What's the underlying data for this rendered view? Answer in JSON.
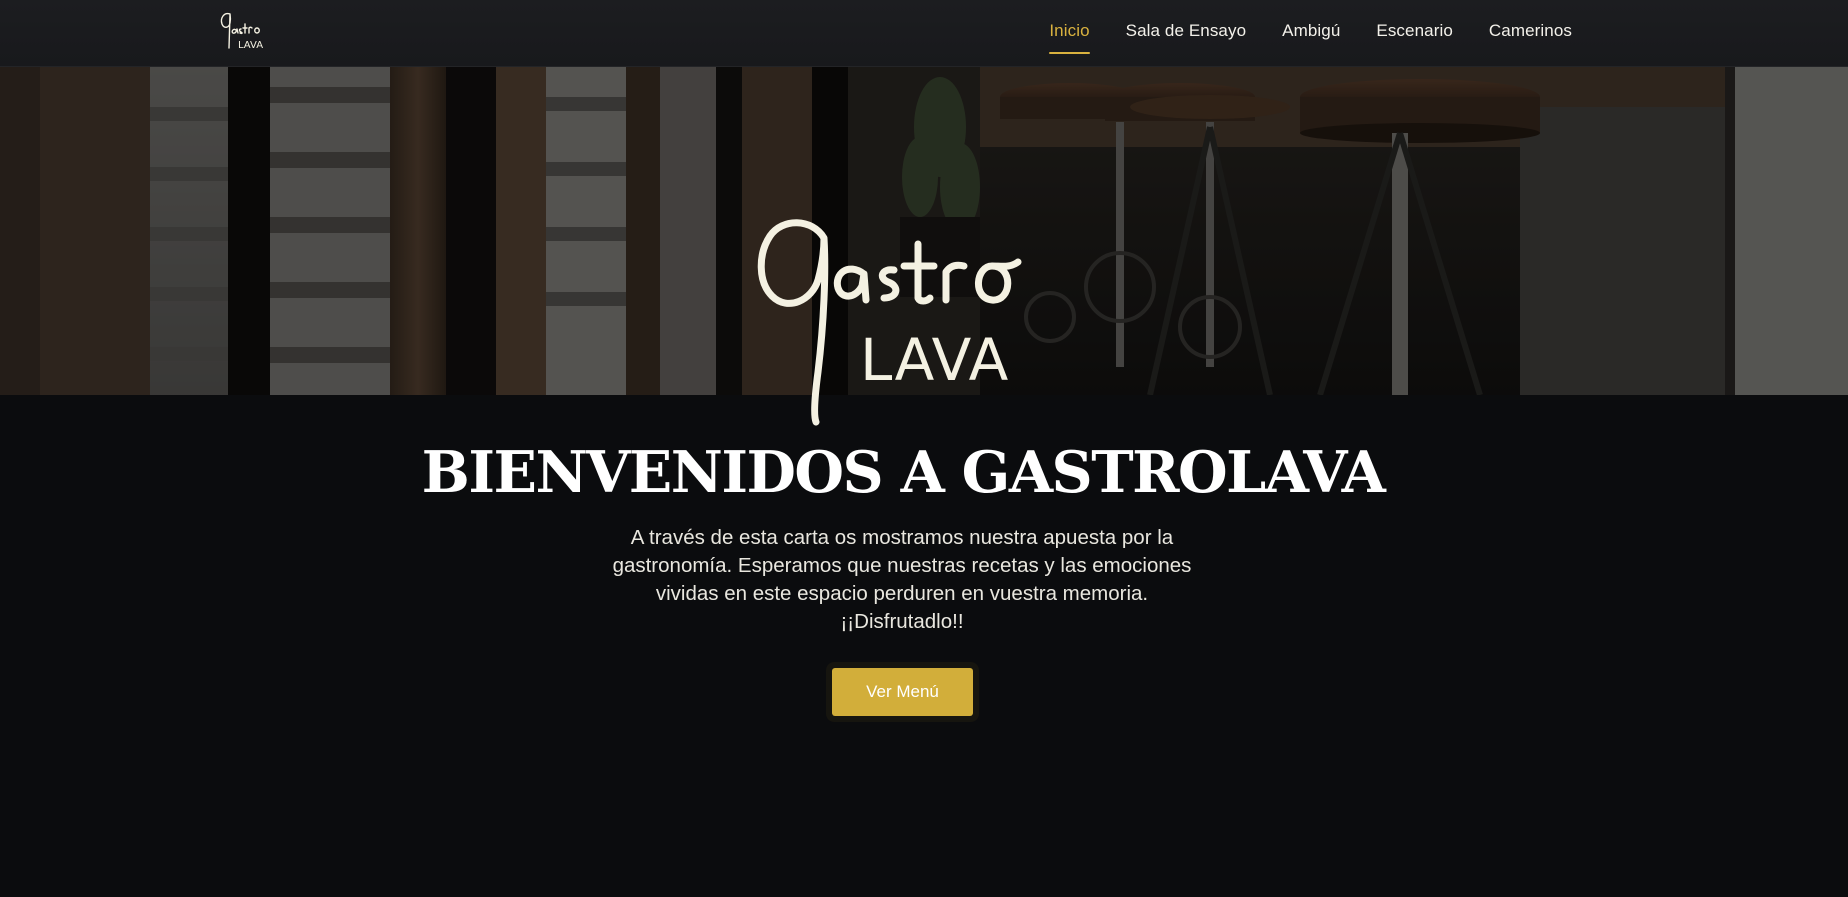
{
  "brand": {
    "logo_script": "Gastro",
    "logo_word": "LAVA"
  },
  "nav": {
    "items": [
      {
        "label": "Inicio",
        "active": true
      },
      {
        "label": "Sala de Ensayo",
        "active": false
      },
      {
        "label": "Ambigú",
        "active": false
      },
      {
        "label": "Escenario",
        "active": false
      },
      {
        "label": "Camerinos",
        "active": false
      }
    ]
  },
  "hero": {
    "title": "BIENVENIDOS A GASTROLAVA",
    "description": "A través de esta carta os mostramos nuestra apuesta por la gastronomía. Esperamos que nuestras recetas y las emociones vividas en este espacio perduren en vuestra memoria. ¡¡Disfrutadlo!!",
    "button_label": "Ver Menú"
  },
  "colors": {
    "accent": "#d9b23f",
    "button": "#d2ae3a",
    "background": "#0b0c0e",
    "navbar": "#1b1c1f",
    "logo_cream": "#f4f1e2"
  }
}
